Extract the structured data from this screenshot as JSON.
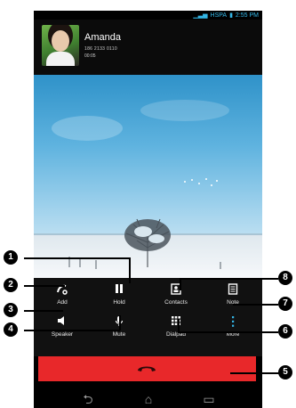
{
  "status": {
    "network": "HSPA",
    "time": "2:55 PM"
  },
  "caller": {
    "name": "Amanda",
    "number": "186 2133 0110",
    "duration": "00:05"
  },
  "controls": {
    "add": "Add",
    "hold": "Hold",
    "contacts": "Contacts",
    "note": "Note",
    "speaker": "Speaker",
    "mute": "Mute",
    "dialpad": "Dialpad",
    "more": "More"
  },
  "callouts": [
    "1",
    "2",
    "3",
    "4",
    "5",
    "6",
    "7",
    "8"
  ],
  "colors": {
    "end_call": "#e8282a",
    "accent": "#33b5e5"
  },
  "icons": {
    "add": "add-call-icon",
    "hold": "pause-icon",
    "contacts": "contacts-icon",
    "note": "note-icon",
    "speaker": "speaker-icon",
    "mute": "microphone-icon",
    "dialpad": "dialpad-icon",
    "more": "more-icon",
    "end": "end-call-icon",
    "back": "back-icon",
    "home": "home-icon",
    "recent": "recent-apps-icon"
  }
}
